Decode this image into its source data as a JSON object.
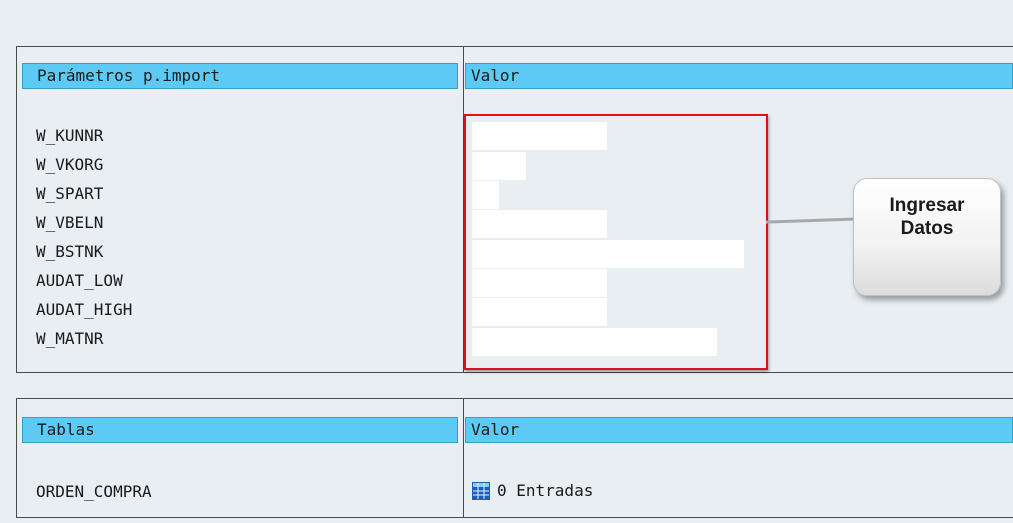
{
  "import_section": {
    "header_param": "Parámetros p.import",
    "header_value": "Valor",
    "params": [
      {
        "name": "W_KUNNR",
        "value": ""
      },
      {
        "name": "W_VKORG",
        "value": ""
      },
      {
        "name": "W_SPART",
        "value": ""
      },
      {
        "name": "W_VBELN",
        "value": ""
      },
      {
        "name": "W_BSTNK",
        "value": ""
      },
      {
        "name": "AUDAT_LOW",
        "value": ""
      },
      {
        "name": "AUDAT_HIGH",
        "value": ""
      },
      {
        "name": "W_MATNR",
        "value": ""
      }
    ]
  },
  "callout": {
    "line1": "Ingresar",
    "line2": "Datos",
    "border_color": "#e0101a"
  },
  "tables_section": {
    "header_table": "Tablas",
    "header_value": "Valor",
    "rows": [
      {
        "name": "ORDEN_COMPRA",
        "icon": "table-icon",
        "entries_text": "0 Entradas"
      }
    ]
  },
  "colors": {
    "header_bg": "#5ccaf4",
    "page_bg": "#e9eef3",
    "input_bg": "#ffffff"
  }
}
